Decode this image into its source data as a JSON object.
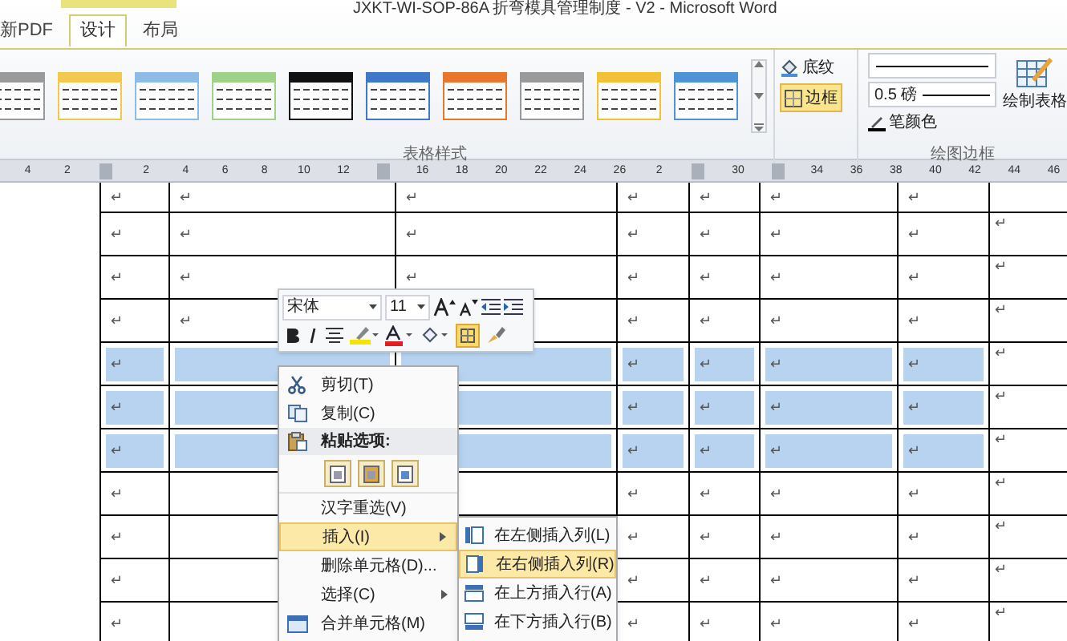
{
  "window": {
    "title": "JXKT-WI-SOP-86A 折弯模具管理制度 - V2 - Microsoft Word"
  },
  "tabs": [
    {
      "label": "新PDF",
      "selected": false
    },
    {
      "label": "设计",
      "selected": true
    },
    {
      "label": "布局",
      "selected": false
    }
  ],
  "ribbon": {
    "table_styles": {
      "label": "表格样式",
      "styles": [
        {
          "color": "#9a9a9a"
        },
        {
          "color": "#f2c94c"
        },
        {
          "color": "#8fbce6"
        },
        {
          "color": "#9fd18a"
        },
        {
          "color": "#111111"
        },
        {
          "color": "#3f78c8"
        },
        {
          "color": "#e8762c"
        },
        {
          "color": "#9a9a9a"
        },
        {
          "color": "#f2c236"
        },
        {
          "color": "#4f92d6"
        }
      ]
    },
    "shading": "底纹",
    "border": {
      "label": "边框",
      "active": true
    },
    "line_weight": "0.5 磅",
    "pen_color": "笔颜色",
    "draw_table": "绘制表格",
    "group_label": "绘图边框"
  },
  "ruler": [
    {
      "kind": "number",
      "label": "4"
    },
    {
      "kind": "number",
      "label": "2"
    },
    {
      "kind": "marker"
    },
    {
      "kind": "number",
      "label": "2"
    },
    {
      "kind": "number",
      "label": "4"
    },
    {
      "kind": "number",
      "label": "6"
    },
    {
      "kind": "number",
      "label": "8"
    },
    {
      "kind": "number",
      "label": "10"
    },
    {
      "kind": "number",
      "label": "12"
    },
    {
      "kind": "marker"
    },
    {
      "kind": "number",
      "label": "16"
    },
    {
      "kind": "number",
      "label": "18"
    },
    {
      "kind": "number",
      "label": "20"
    },
    {
      "kind": "number",
      "label": "22"
    },
    {
      "kind": "number",
      "label": "24"
    },
    {
      "kind": "number",
      "label": "26"
    },
    {
      "kind": "number",
      "label": "2"
    },
    {
      "kind": "marker"
    },
    {
      "kind": "number",
      "label": "30"
    },
    {
      "kind": "marker"
    },
    {
      "kind": "number",
      "label": "34"
    },
    {
      "kind": "number",
      "label": "36"
    },
    {
      "kind": "number",
      "label": "38"
    },
    {
      "kind": "number",
      "label": "40"
    },
    {
      "kind": "number",
      "label": "42"
    },
    {
      "kind": "number",
      "label": "44"
    },
    {
      "kind": "number",
      "label": "46"
    }
  ],
  "table": {
    "rows": [
      {
        "highlighted": false,
        "cells": [
          "↵",
          "↵",
          "↵",
          "↵",
          "↵",
          "↵",
          "↵"
        ]
      },
      {
        "highlighted": false,
        "cells": [
          "↵",
          "↵",
          "↵",
          "↵",
          "↵",
          "↵",
          "↵"
        ],
        "end": "↵"
      },
      {
        "highlighted": false,
        "cells": [
          "↵",
          "↵",
          "↵",
          "↵",
          "↵",
          "↵",
          "↵"
        ],
        "end": "↵"
      },
      {
        "highlighted": false,
        "cells": [
          "↵",
          "↵",
          null,
          "↵",
          "↵",
          "↵",
          "↵"
        ],
        "end": "↵"
      },
      {
        "highlighted": true,
        "cells": [
          "↵",
          null,
          null,
          "↵",
          "↵",
          "↵",
          "↵"
        ],
        "end": "↵"
      },
      {
        "highlighted": true,
        "cells": [
          "↵",
          null,
          null,
          "↵",
          "↵",
          "↵",
          "↵"
        ],
        "end": "↵"
      },
      {
        "highlighted": true,
        "cells": [
          "↵",
          null,
          null,
          "↵",
          "↵",
          "↵",
          "↵"
        ],
        "end": "↵"
      },
      {
        "highlighted": false,
        "cells": [
          "↵",
          null,
          null,
          "↵",
          "↵",
          "↵",
          "↵"
        ],
        "end": "↵"
      },
      {
        "highlighted": false,
        "cells": [
          "↵",
          null,
          null,
          "↵",
          "↵",
          "↵",
          "↵"
        ],
        "end": "↵"
      },
      {
        "highlighted": false,
        "cells": [
          "↵",
          null,
          null,
          "↵",
          "↵",
          "↵",
          "↵"
        ],
        "end": "↵"
      },
      {
        "highlighted": false,
        "cells": [
          "↵",
          null,
          null,
          "↵",
          "↵",
          "↵",
          "↵"
        ],
        "end": "↵"
      }
    ]
  },
  "mini_toolbar": {
    "font": "宋体",
    "size": "11"
  },
  "context_menu": {
    "items": [
      {
        "kind": "item",
        "label": "剪切(T)",
        "selected": false
      },
      {
        "kind": "item",
        "label": "复制(C)",
        "selected": false
      },
      {
        "kind": "header",
        "label": "粘贴选项:"
      },
      {
        "kind": "paste_options"
      },
      {
        "kind": "item",
        "label": "汉字重选(V)",
        "selected": false
      },
      {
        "kind": "submenu",
        "label": "插入(I)",
        "selected": true
      },
      {
        "kind": "item",
        "label": "删除单元格(D)...",
        "selected": false
      },
      {
        "kind": "submenu",
        "label": "选择(C)",
        "selected": false
      },
      {
        "kind": "item",
        "label": "合并单元格(M)",
        "selected": false
      }
    ]
  },
  "submenu": {
    "items": [
      {
        "label": "在左侧插入列(L)",
        "selected": false
      },
      {
        "label": "在右侧插入列(R)",
        "selected": true
      },
      {
        "label": "在上方插入行(A)",
        "selected": false
      },
      {
        "label": "在下方插入行(B)",
        "selected": false
      }
    ]
  }
}
